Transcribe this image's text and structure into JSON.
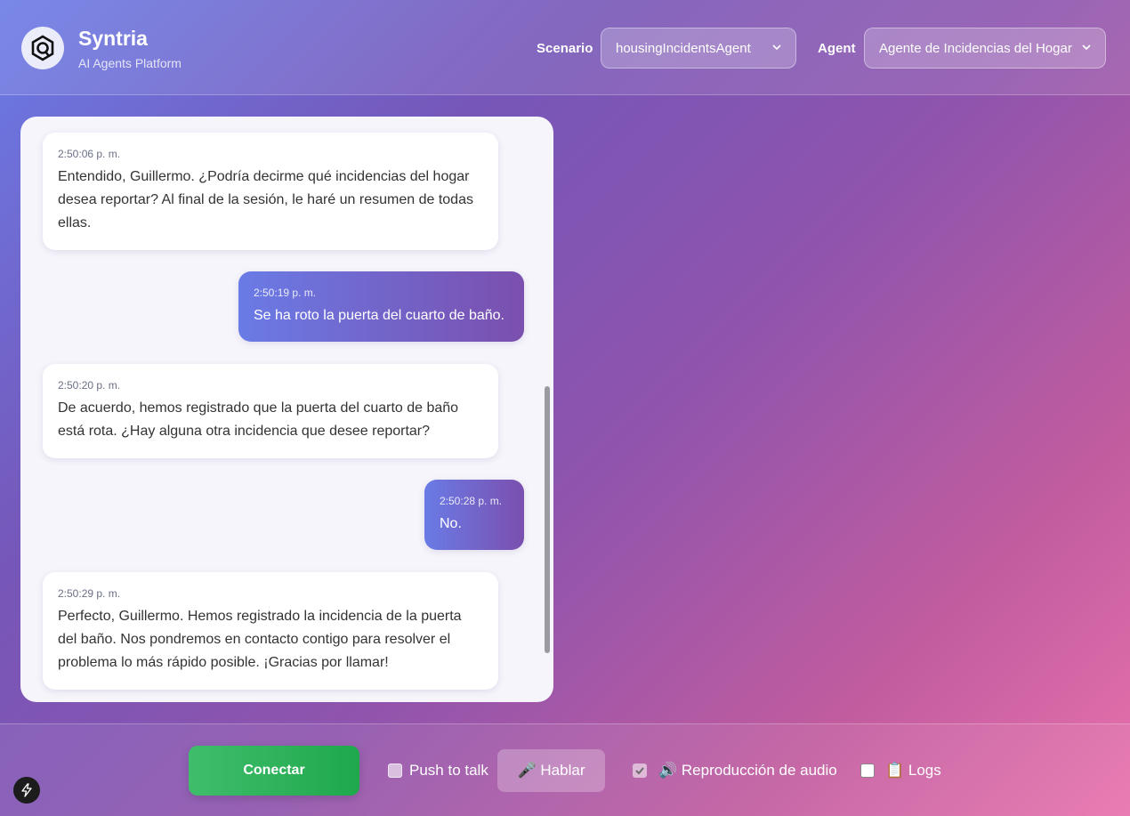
{
  "header": {
    "brand_name": "Syntria",
    "brand_sub": "AI Agents Platform",
    "scenario_label": "Scenario",
    "scenario_value": "housingIncidentsAgent",
    "agent_label": "Agent",
    "agent_value": "Agente de Incidencias del Hogar"
  },
  "messages": [
    {
      "role": "agent",
      "time": "2:50:06 p. m.",
      "text": "Entendido, Guillermo. ¿Podría decirme qué incidencias del hogar desea reportar? Al final de la sesión, le haré un resumen de todas ellas."
    },
    {
      "role": "user",
      "time": "2:50:19 p. m.",
      "text": "Se ha roto la puerta del cuarto de baño."
    },
    {
      "role": "agent",
      "time": "2:50:20 p. m.",
      "text": "De acuerdo, hemos registrado que la puerta del cuarto de baño está rota. ¿Hay alguna otra incidencia que desee reportar?"
    },
    {
      "role": "user",
      "time": "2:50:28 p. m.",
      "text": "No."
    },
    {
      "role": "agent",
      "time": "2:50:29 p. m.",
      "text": "Perfecto, Guillermo. Hemos registrado la incidencia de la puerta del baño. Nos pondremos en contacto contigo para resolver el problema lo más rápido posible. ¡Gracias por llamar!"
    }
  ],
  "controls": {
    "connect_label": "Conectar",
    "push_to_talk_label": "Push to talk",
    "push_to_talk_checked": false,
    "talk_button_label": "🎤 Hablar",
    "audio_playback_label": "🔊 Reproducción de audio",
    "audio_playback_checked": true,
    "logs_label": "📋 Logs",
    "logs_checked": false
  },
  "colors": {
    "accent_gradient_start": "#6a7be6",
    "accent_gradient_end": "#7b4fae",
    "connect_green": "#22a94f"
  }
}
